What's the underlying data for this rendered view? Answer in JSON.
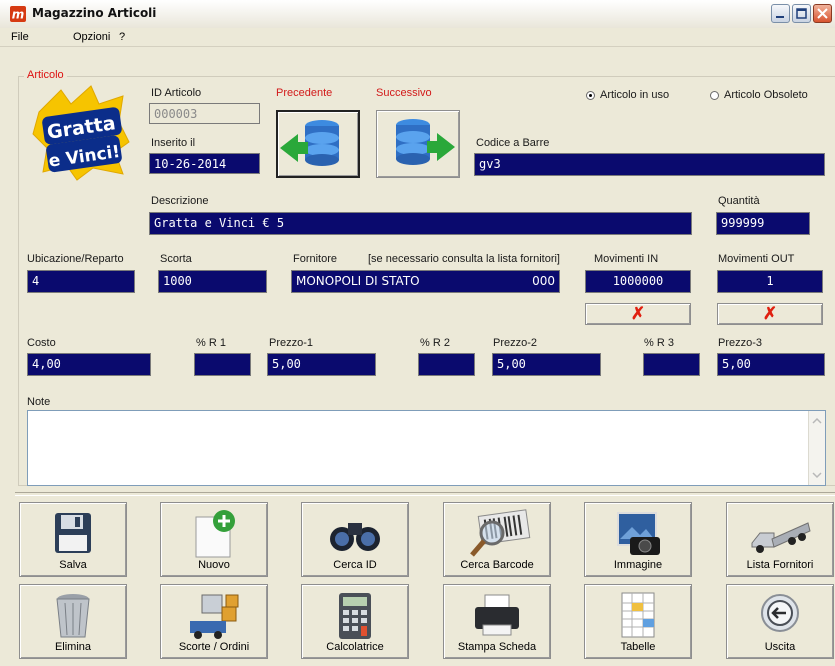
{
  "window": {
    "title": "Magazzino Articoli",
    "app_icon": "m-logo-icon"
  },
  "menu": {
    "items": [
      "File",
      "Opzioni",
      "?"
    ]
  },
  "group": {
    "label": "Articolo"
  },
  "logo": {
    "line1": "Gratta",
    "line2": "e Vinci!"
  },
  "fields": {
    "id_articolo": {
      "label": "ID Articolo",
      "value": "000003"
    },
    "inserito_il": {
      "label": "Inserito il",
      "value": "10-26-2014"
    },
    "codice_barre": {
      "label": "Codice a Barre",
      "value": "gv3"
    },
    "descrizione": {
      "label": "Descrizione",
      "value": "Gratta e Vinci € 5"
    },
    "quantita": {
      "label": "Quantità",
      "value": "999999"
    },
    "ubicazione": {
      "label": "Ubicazione/Reparto",
      "value": "4"
    },
    "scorta": {
      "label": "Scorta",
      "value": "1000"
    },
    "fornitore": {
      "label": "Fornitore",
      "hint": "[se necessario consulta la lista fornitori]",
      "value": "MONOPOLI DI STATO",
      "code": "000"
    },
    "movimenti_in": {
      "label": "Movimenti IN",
      "value": "1000000"
    },
    "movimenti_out": {
      "label": "Movimenti OUT",
      "value": "1"
    },
    "costo": {
      "label": "Costo",
      "value": "4,00"
    },
    "r1": {
      "label": "% R 1",
      "value": ""
    },
    "prezzo1": {
      "label": "Prezzo-1",
      "value": "5,00"
    },
    "r2": {
      "label": "% R 2",
      "value": ""
    },
    "prezzo2": {
      "label": "Prezzo-2",
      "value": "5,00"
    },
    "r3": {
      "label": "% R 3",
      "value": ""
    },
    "prezzo3": {
      "label": "Prezzo-3",
      "value": "5,00"
    },
    "note": {
      "label": "Note",
      "value": ""
    }
  },
  "nav": {
    "prev_label": "Precedente",
    "next_label": "Successivo"
  },
  "status": {
    "in_uso": "Articolo in uso",
    "obsoleto": "Articolo Obsoleto",
    "selected": "in_uso"
  },
  "buttons": {
    "salva": "Salva",
    "nuovo": "Nuovo",
    "cerca_id": "Cerca ID",
    "cerca_barcode": "Cerca Barcode",
    "immagine": "Immagine",
    "lista_fornitori": "Lista Fornitori",
    "elimina": "Elimina",
    "scorte_ordini": "Scorte / Ordini",
    "calcolatrice": "Calcolatrice",
    "stampa_scheda": "Stampa Scheda",
    "tabelle": "Tabelle",
    "uscita": "Uscita"
  },
  "colors": {
    "field_bg": "#0a0a6e",
    "label_red": "#d21a1a",
    "window_bg": "#ece9d8",
    "delete_x": "#e02010"
  }
}
